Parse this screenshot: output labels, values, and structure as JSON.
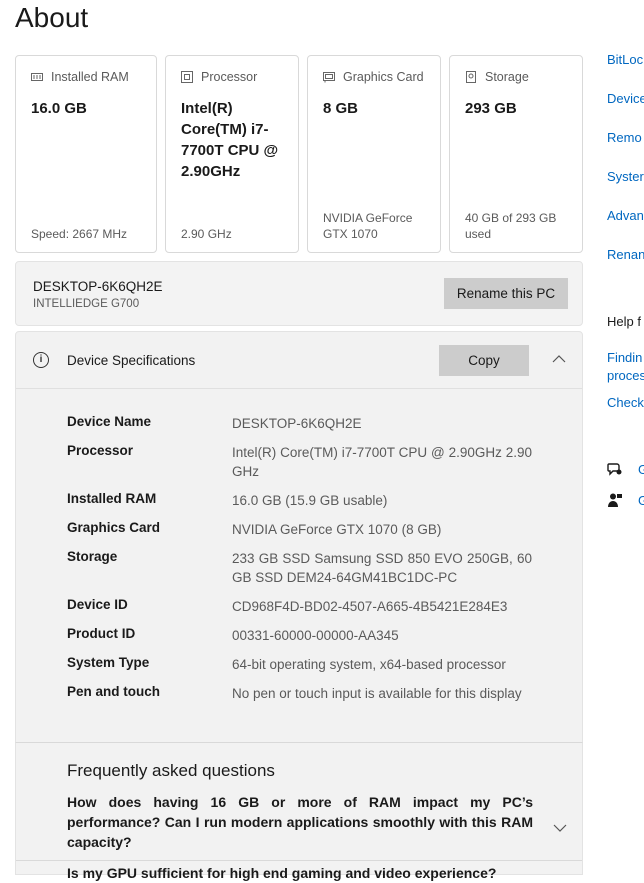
{
  "page": {
    "title": "About"
  },
  "cards": [
    {
      "icon": "ram-icon",
      "label": "Installed RAM",
      "value": "16.0 GB",
      "footer": "Speed: 2667 MHz"
    },
    {
      "icon": "processor-icon",
      "label": "Processor",
      "value": "Intel(R) Core(TM) i7-7700T CPU @ 2.90GHz",
      "footer": "2.90 GHz"
    },
    {
      "icon": "graphics-card-icon",
      "label": "Graphics Card",
      "value": "8 GB",
      "footer": "NVIDIA GeForce GTX 1070"
    },
    {
      "icon": "storage-icon",
      "label": "Storage",
      "value": "293 GB",
      "footer": "40 GB of 293 GB used"
    }
  ],
  "pc": {
    "name": "DESKTOP-6K6QH2E",
    "model": "INTELLIEDGE G700",
    "rename_label": "Rename this PC"
  },
  "specs": {
    "title": "Device Specifications",
    "copy_label": "Copy",
    "rows": [
      {
        "key": "Device Name",
        "value": "DESKTOP-6K6QH2E"
      },
      {
        "key": "Processor",
        "value": "Intel(R) Core(TM) i7-7700T CPU @ 2.90GHz 2.90 GHz"
      },
      {
        "key": "Installed RAM",
        "value": "16.0 GB (15.9 GB usable)"
      },
      {
        "key": "Graphics Card",
        "value": "NVIDIA GeForce GTX 1070 (8 GB)"
      },
      {
        "key": "Storage",
        "value": "233 GB SSD Samsung SSD 850 EVO 250GB, 60 GB SSD DEM24-64GM41BC1DC-PC"
      },
      {
        "key": "Device ID",
        "value": "CD968F4D-BD02-4507-A665-4B5421E284E3"
      },
      {
        "key": "Product ID",
        "value": "00331-60000-00000-AA345"
      },
      {
        "key": "System Type",
        "value": "64-bit operating system, x64-based processor"
      },
      {
        "key": "Pen and touch",
        "value": "No pen or touch input is available for this display"
      }
    ]
  },
  "faq": {
    "title": "Frequently asked questions",
    "questions": [
      "How does having 16 GB or more of RAM impact my PC’s performance? Can I run modern applications smoothly with this RAM capacity?",
      "Is my GPU sufficient for high end gaming and video experience?"
    ]
  },
  "sidebar": {
    "links": [
      "BitLoc",
      "Device",
      "Remo",
      "Syster",
      "Advan",
      "Renan"
    ],
    "help_heading": "Help f",
    "help_links": [
      "Findin",
      "proces",
      "Check"
    ],
    "contact": [
      "G",
      "G"
    ]
  }
}
